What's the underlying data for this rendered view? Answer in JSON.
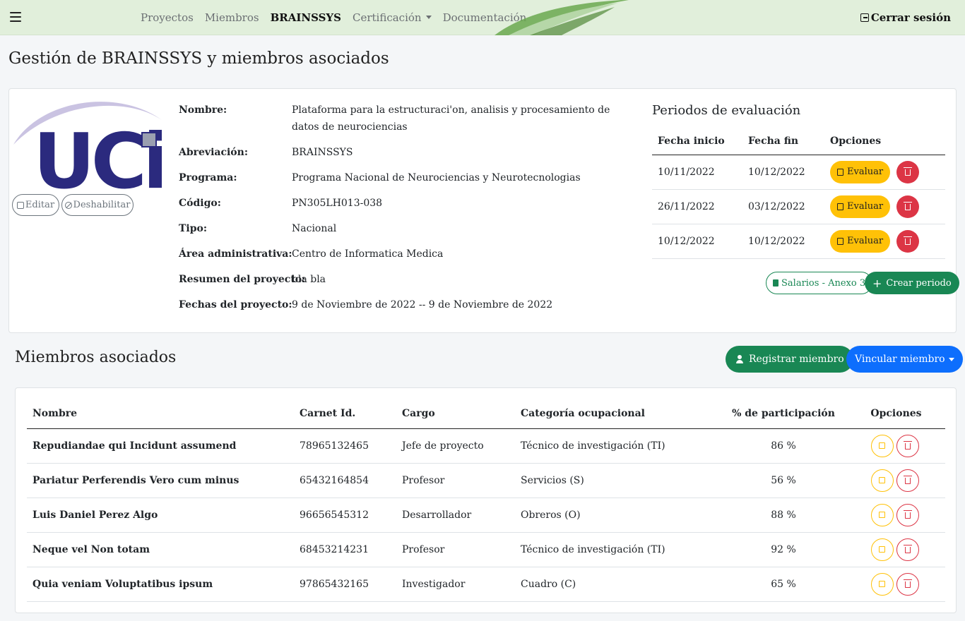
{
  "nav": {
    "links": [
      "Proyectos",
      "Miembros",
      "BRAINSSYS",
      "Certificación",
      "Documentación"
    ],
    "logout": "Cerrar sesión"
  },
  "page_title": "Gestión de BRAINSSYS y miembros asociados",
  "project": {
    "logo_text": "UCi",
    "edit_label": "Editar",
    "disable_label": "Deshabilitar",
    "fields": [
      {
        "label": "Nombre:",
        "value": "Plataforma para la estructuraci'on, analisis y procesamiento de datos de neurociencias"
      },
      {
        "label": "Abreviación:",
        "value": "BRAINSSYS"
      },
      {
        "label": "Programa:",
        "value": "Programa Nacional de Neurociencias y Neurotecnologias"
      },
      {
        "label": "Código:",
        "value": "PN305LH013-038"
      },
      {
        "label": "Tipo:",
        "value": "Nacional"
      },
      {
        "label": "Área administrativa:",
        "value": "Centro de Informatica Medica"
      },
      {
        "label": "Resumen del proyecto:",
        "value": "bla bla"
      },
      {
        "label": "Fechas del proyecto:",
        "value": "9 de Noviembre de 2022 -- 9 de Noviembre de 2022"
      }
    ]
  },
  "periods": {
    "title": "Periodos de evaluación",
    "headers": [
      "Fecha inicio",
      "Fecha fin",
      "Opciones"
    ],
    "evaluate_label": "Evaluar",
    "rows": [
      {
        "start": "10/11/2022",
        "end": "10/12/2022"
      },
      {
        "start": "26/11/2022",
        "end": "03/12/2022"
      },
      {
        "start": "10/12/2022",
        "end": "10/12/2022"
      }
    ],
    "salarios_label": "Salarios - Anexo 3",
    "crear_label": "Crear periodo"
  },
  "members": {
    "title": "Miembros asociados",
    "register_label": "Registrar miembro",
    "link_label": "Vincular miembro",
    "headers": [
      "Nombre",
      "Carnet Id.",
      "Cargo",
      "Categoría ocupacional",
      "% de participación",
      "Opciones"
    ],
    "rows": [
      {
        "name": "Repudiandae qui Incidunt assumend",
        "carnet": "78965132465",
        "cargo": "Jefe de proyecto",
        "categoria": "Técnico de investigación (TI)",
        "pct": "86 %"
      },
      {
        "name": "Pariatur Perferendis Vero cum minus",
        "carnet": "65432164854",
        "cargo": "Profesor",
        "categoria": "Servicios (S)",
        "pct": "56 %"
      },
      {
        "name": "Luis Daniel Perez Algo",
        "carnet": "96656545312",
        "cargo": "Desarrollador",
        "categoria": "Obreros (O)",
        "pct": "88 %"
      },
      {
        "name": "Neque vel Non totam",
        "carnet": "68453214231",
        "cargo": "Profesor",
        "categoria": "Técnico de investigación (TI)",
        "pct": "92 %"
      },
      {
        "name": "Quia veniam Voluptatibus ipsum",
        "carnet": "97865432165",
        "cargo": "Investigador",
        "categoria": "Cuadro (C)",
        "pct": "65 %"
      }
    ]
  },
  "colors": {
    "navbar": "#e1efdb",
    "logo": "#2b2a7e",
    "success": "#198754",
    "warning": "#ffc107",
    "danger": "#dc3545",
    "primary": "#0d6efd"
  }
}
